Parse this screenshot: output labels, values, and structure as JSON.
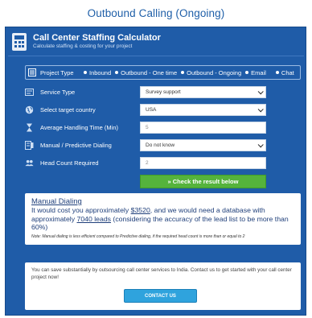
{
  "page_title": "Outbound Calling (Ongoing)",
  "header": {
    "title": "Call Center Staffing Calculator",
    "subtitle": "Calculate staffing & costing for your project"
  },
  "project_type": {
    "label": "Project Type",
    "options": [
      "Inbound",
      "Outbound - One time",
      "Outbound - Ongoing",
      "Email",
      "Chat"
    ],
    "selected": "Outbound - Ongoing"
  },
  "fields": {
    "service_type": {
      "label": "Service Type",
      "value": "Survey support"
    },
    "country": {
      "label": "Select target country",
      "value": "USA"
    },
    "aht": {
      "label": "Average Handling Time (Min)",
      "value": "5"
    },
    "dialing": {
      "label": "Manual / Predictive Dialing",
      "value": "Do not know"
    },
    "headcount": {
      "label": "Head Count Required",
      "value": "2"
    }
  },
  "check_button": "» Check the result below",
  "result": {
    "title": "Manual Dialing",
    "text_1": "It would cost you approximately ",
    "cost": "$3520",
    "text_2": ", and we would need a database with approximately ",
    "leads": "7040 leads",
    "text_3": " (considering the accuracy of the lead list to be more than 60%)",
    "note": "Note: Manual dialing is less efficient compared to Predictive dialing, if the required head count is more than or equal to 2"
  },
  "save": {
    "text": "You can save substantially by outsourcing call center services to India. Contact us to get started with your call center project now!",
    "button": "CONTACT US"
  },
  "colors": {
    "panel_blue": "#1f5ca8",
    "title_blue": "#1f5fa8",
    "check_green": "#55b33c",
    "contact_blue": "#2fa3dd"
  }
}
